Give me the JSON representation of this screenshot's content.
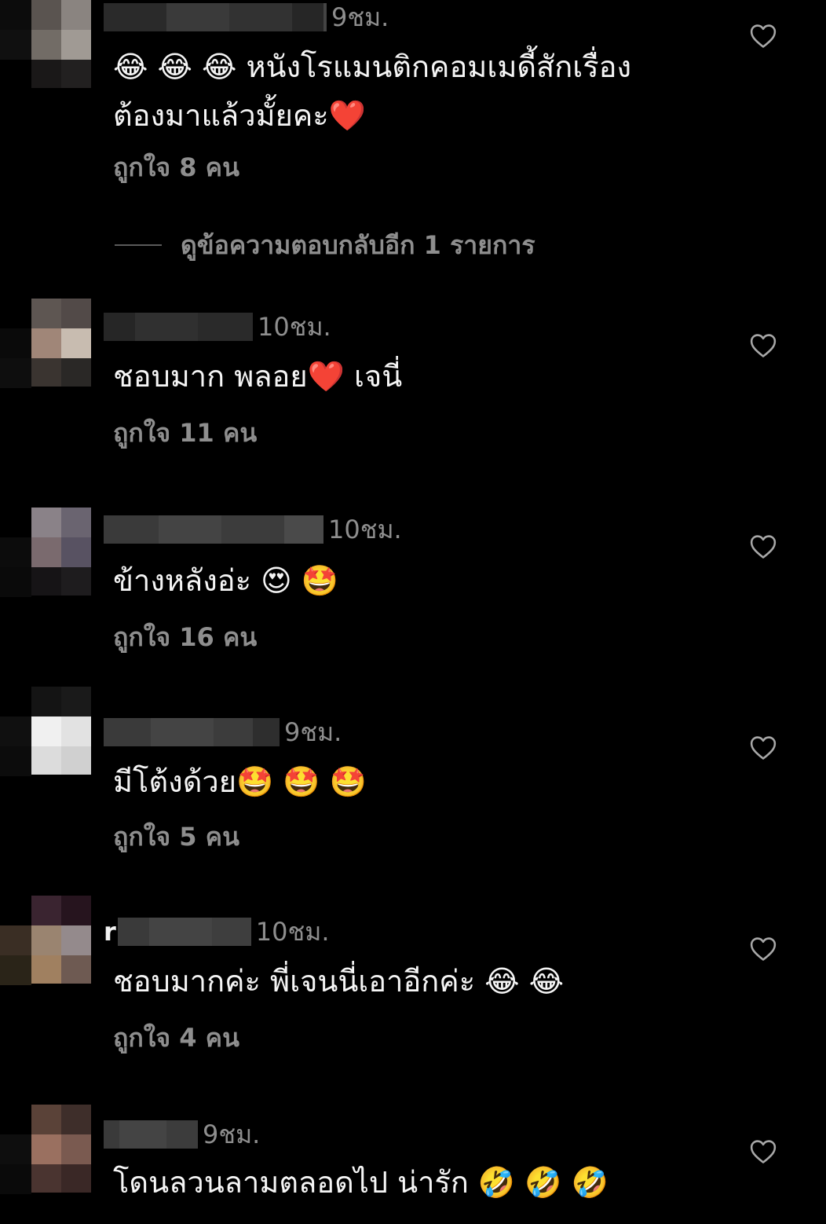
{
  "comments": [
    {
      "time": "9ชม.",
      "username_visible": "",
      "text": "😂 😂 😂 หนังโรแมนติกคอมเมดี้สักเรื่อง\nต้องมาแล้วมั้ยคะ❤️",
      "likes": "ถูกใจ 8 คน",
      "avatar_colors": [
        "#5a5450",
        "#8a8480",
        "#726c66",
        "#a09a94",
        "#1a1818",
        "#222020"
      ],
      "view_replies": "ดูข้อความตอบกลับอีก 1 รายการ"
    },
    {
      "time": "10ชม.",
      "username_visible": "",
      "text": "ชอบมาก พลอย❤️ เจนี่",
      "likes": "ถูกใจ 11 คน",
      "avatar_colors": [
        "#5e5652",
        "#524a48",
        "#a08678",
        "#c8bcb0",
        "#3a3430",
        "#2a2826"
      ]
    },
    {
      "time": "10ชม.",
      "username_visible": "",
      "text": "ข้างหลังอ่ะ 😍 🤩",
      "likes": "ถูกใจ 16 คน",
      "avatar_colors": [
        "#8a8288",
        "#6a6470",
        "#7a6a6e",
        "#585262",
        "#161416",
        "#1e1c1e"
      ]
    },
    {
      "time": "9ชม.",
      "username_visible": "",
      "text": "มีโต้งด้วย🤩 🤩 🤩",
      "likes": "ถูกใจ 5 คน",
      "avatar_colors": [
        "#141414",
        "#1a1a1a",
        "#f0f0f0",
        "#e2e2e2",
        "#dcdcdc",
        "#d0d0d0"
      ]
    },
    {
      "time": "10ชม.",
      "username_visible": "r",
      "text": "ชอบมากค่ะ พี่เจนนี่เอาอีกค่ะ 😂 😂",
      "likes": "ถูกใจ 4 คน",
      "avatar_colors": [
        "#3a2430",
        "#26141e",
        "#9a8470",
        "#948a8c",
        "#a08060",
        "#6e5a52"
      ]
    },
    {
      "time": "9ชม.",
      "username_visible": "",
      "text": "โดนลวนลามตลอดไป น่ารัก 🤣 🤣 🤣",
      "likes": "",
      "avatar_colors": [
        "#5a4238",
        "#3e2e2a",
        "#9a7060",
        "#7a5a50",
        "#4a3430",
        "#3a2826"
      ]
    }
  ],
  "colors": {
    "background": "#000000",
    "text": "#f5f5f5",
    "secondary": "#8e8e8e"
  },
  "icons": {
    "like": "heart-outline-icon"
  }
}
